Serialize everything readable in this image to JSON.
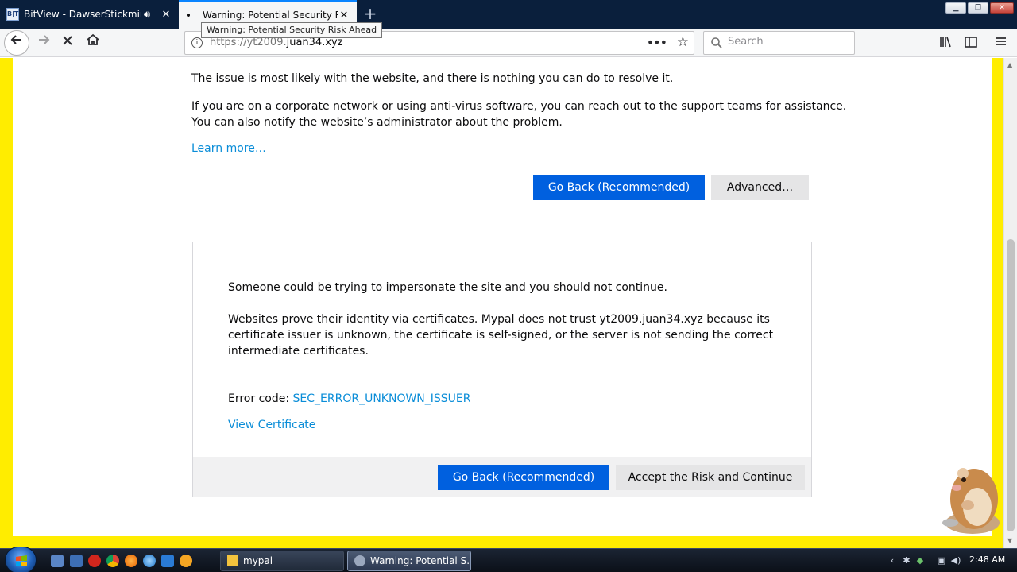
{
  "tabs": [
    {
      "title": "BitView - DawserStickmin's",
      "favicon": "B|T",
      "icon": "speaker-icon"
    },
    {
      "title": "Warning: Potential Security Ris",
      "icon": "loading-dot"
    }
  ],
  "tooltip": "Warning: Potential Security Risk Ahead",
  "navbar": {
    "url_prefix": "https://yt2009.",
    "url_host": "juan34.xyz",
    "search_placeholder": "Search",
    "more_glyph": "•••"
  },
  "page": {
    "p1": "The issue is most likely with the website, and there is nothing you can do to resolve it.",
    "p2": "If you are on a corporate network or using anti-virus software, you can reach out to the support teams for assistance.",
    "p3": "You can also notify the website’s administrator about the problem.",
    "learn_more": "Learn more…",
    "go_back": "Go Back (Recommended)",
    "advanced": "Advanced…"
  },
  "advanced_panel": {
    "line1": "Someone could be trying to impersonate the site and you should not continue.",
    "line2": "Websites prove their identity via certificates. Mypal does not trust yt2009.juan34.xyz because its",
    "line3": "certificate issuer is unknown, the certificate is self-signed, or the server is not sending the correct",
    "line4": "intermediate certificates.",
    "error_label": "Error code: ",
    "error_code": "SEC_ERROR_UNKNOWN_ISSUER",
    "view_cert": "View Certificate",
    "go_back": "Go Back (Recommended)",
    "accept": "Accept the Risk and Continue"
  },
  "taskbar": {
    "tasks": [
      {
        "label": "mypal"
      },
      {
        "label": "Warning: Potential S..."
      }
    ],
    "clock": "2:48 AM"
  },
  "colors": {
    "accent": "#0060df",
    "link": "#0a8dd8",
    "yellow_border": "#ffed00",
    "tabstrip": "#0a1f3c"
  }
}
